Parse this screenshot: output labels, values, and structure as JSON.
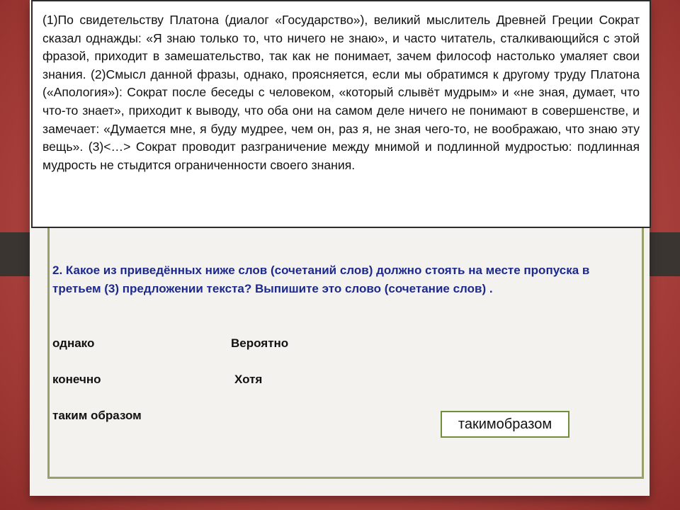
{
  "passage": "(1)По свидетельству Платона (диалог «Государство»), великий мыслитель Древней Греции Сократ сказал однажды: «Я знаю только то, что ничего не знаю», и часто читатель, сталкивающийся с этой фразой, приходит в замешательство, так как не понимает, зачем философ настолько умаляет свои знания. (2)Смысл данной фразы, однако, проясняется, если мы обратимся к другому труду Платона («Апология»): Сократ после беседы с человеком, «который слывёт мудрым» и «не зная, думает, что что-то знает», приходит к выводу, что оба они на самом деле ничего не понимают в совершенстве, и замечает: «Думается мне, я буду мудрее, чем он, раз я, не зная чего-то, не воображаю, что знаю эту вещь». (3)<…> Сократ проводит разграничение между мнимой и подлинной мудростью: подлинная мудрость не стыдится ограниченности своего знания.",
  "question": "2. Какое из приведённых ниже слов (сочетаний слов) должно стоять на месте пропуска в третьем (3) предложении текста? Выпишите это слово (сочетание слов) .",
  "options": [
    "однако",
    "Вероятно",
    "конечно",
    "Хотя",
    "таким образом"
  ],
  "answer": "такимобразом",
  "colors": {
    "question": "#1d2a8c",
    "background": "#b64a45",
    "frame": "#9aa06a"
  }
}
